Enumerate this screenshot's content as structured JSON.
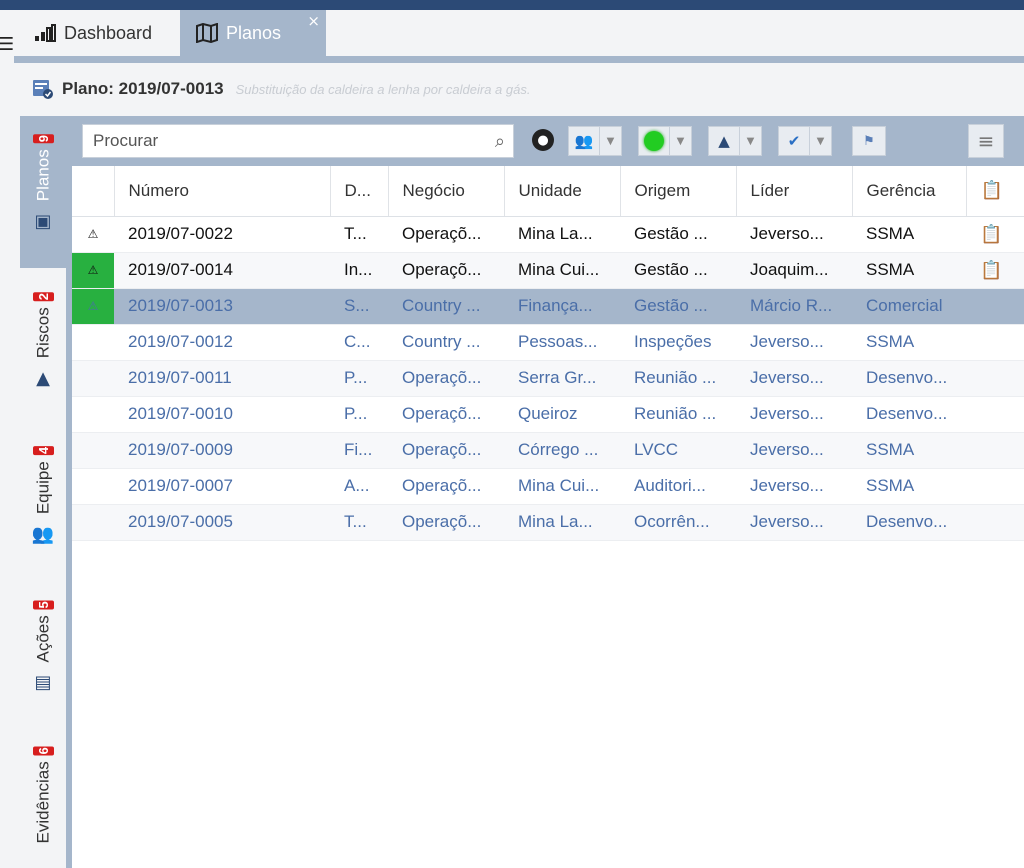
{
  "tabs": {
    "dashboard": "Dashboard",
    "planos": "Planos"
  },
  "plan": {
    "label": "Plano: 2019/07-0013",
    "description": "Substituição da caldeira a lenha por caldeira a gás."
  },
  "side_tabs": [
    {
      "label": "Planos",
      "count": "9",
      "icon": "plans-icon"
    },
    {
      "label": "Riscos",
      "count": "2",
      "icon": "warning-icon"
    },
    {
      "label": "Equipe",
      "count": "4",
      "icon": "team-icon"
    },
    {
      "label": "Ações",
      "count": "5",
      "icon": "actions-icon"
    },
    {
      "label": "Evidências",
      "count": "6",
      "icon": "evidence-icon"
    }
  ],
  "search": {
    "placeholder": "Procurar"
  },
  "columns": [
    "Número",
    "D...",
    "Negócio",
    "Unidade",
    "Origem",
    "Líder",
    "Gerência"
  ],
  "rows": [
    {
      "flag": "⚠",
      "numero": "2019/07-0022",
      "d": "T...",
      "negocio": "Operaçõ...",
      "unidade": "Mina La...",
      "origem": "Gestão ...",
      "lider": "Jeverso...",
      "gerencia": "SSMA",
      "clip": true
    },
    {
      "flag": "⚠",
      "numero": "2019/07-0014",
      "d": "In...",
      "negocio": "Operaçõ...",
      "unidade": "Mina Cui...",
      "origem": "Gestão ...",
      "lider": "Joaquim...",
      "gerencia": "SSMA",
      "clip": true
    },
    {
      "flag": "⚠",
      "numero": "2019/07-0013",
      "d": "S...",
      "negocio": "Country ...",
      "unidade": "Finança...",
      "origem": "Gestão ...",
      "lider": "Márcio R...",
      "gerencia": "Comercial",
      "clip": false
    },
    {
      "flag": "",
      "numero": "2019/07-0012",
      "d": "C...",
      "negocio": "Country ...",
      "unidade": "Pessoas...",
      "origem": "Inspeções",
      "lider": "Jeverso...",
      "gerencia": "SSMA",
      "clip": false
    },
    {
      "flag": "",
      "numero": "2019/07-0011",
      "d": "P...",
      "negocio": "Operaçõ...",
      "unidade": "Serra Gr...",
      "origem": "Reunião ...",
      "lider": "Jeverso...",
      "gerencia": "Desenvo...",
      "clip": false
    },
    {
      "flag": "",
      "numero": "2019/07-0010",
      "d": "P...",
      "negocio": "Operaçõ...",
      "unidade": "Queiroz",
      "origem": "Reunião ...",
      "lider": "Jeverso...",
      "gerencia": "Desenvo...",
      "clip": false
    },
    {
      "flag": "",
      "numero": "2019/07-0009",
      "d": "Fi...",
      "negocio": "Operaçõ...",
      "unidade": "Córrego ...",
      "origem": "LVCC",
      "lider": "Jeverso...",
      "gerencia": "SSMA",
      "clip": false
    },
    {
      "flag": "",
      "numero": "2019/07-0007",
      "d": "A...",
      "negocio": "Operaçõ...",
      "unidade": "Mina Cui...",
      "origem": "Auditori...",
      "lider": "Jeverso...",
      "gerencia": "SSMA",
      "clip": false
    },
    {
      "flag": "",
      "numero": "2019/07-0005",
      "d": "T...",
      "negocio": "Operaçõ...",
      "unidade": "Mina La...",
      "origem": "Ocorrên...",
      "lider": "Jeverso...",
      "gerencia": "Desenvo...",
      "clip": false
    }
  ],
  "colors": {
    "accent": "#a5b6cb",
    "header": "#2c4a76",
    "link": "#4a6ea8",
    "flag_green": "#28b040",
    "badge": "#d71e1e"
  }
}
